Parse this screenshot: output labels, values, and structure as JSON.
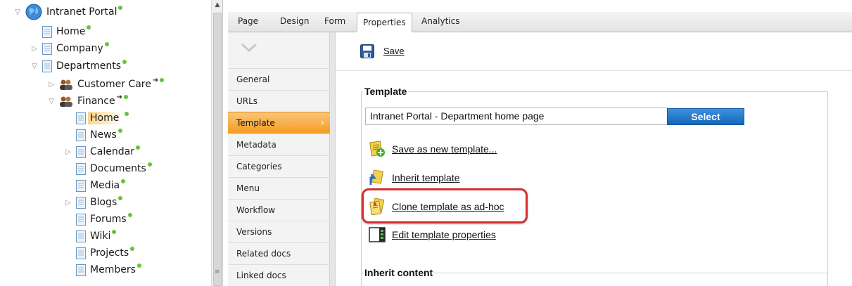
{
  "tree": {
    "items": [
      {
        "label": "Intranet Portal",
        "toggle": "expanded",
        "icon": "globe-icon",
        "dot": true,
        "arrow": false,
        "selected": false
      },
      {
        "label": "Home",
        "toggle": "none",
        "icon": "page-icon",
        "dot": true,
        "arrow": false,
        "selected": false
      },
      {
        "label": "Company",
        "toggle": "collapsed",
        "icon": "page-icon",
        "dot": true,
        "arrow": false,
        "selected": false
      },
      {
        "label": "Departments",
        "toggle": "expanded",
        "icon": "page-icon",
        "dot": true,
        "arrow": false,
        "selected": false
      },
      {
        "label": "Customer Care",
        "toggle": "collapsed",
        "icon": "people-icon",
        "dot": true,
        "arrow": true,
        "selected": false
      },
      {
        "label": "Finance",
        "toggle": "expanded",
        "icon": "people-icon",
        "dot": true,
        "arrow": true,
        "selected": false
      },
      {
        "label": "Home",
        "toggle": "none",
        "icon": "page-icon",
        "dot": true,
        "arrow": false,
        "selected": true
      },
      {
        "label": "News",
        "toggle": "none",
        "icon": "page-icon",
        "dot": true,
        "arrow": false,
        "selected": false
      },
      {
        "label": "Calendar",
        "toggle": "collapsed",
        "icon": "page-icon",
        "dot": true,
        "arrow": false,
        "selected": false
      },
      {
        "label": "Documents",
        "toggle": "none",
        "icon": "page-icon",
        "dot": true,
        "arrow": false,
        "selected": false
      },
      {
        "label": "Media",
        "toggle": "none",
        "icon": "page-icon",
        "dot": true,
        "arrow": false,
        "selected": false
      },
      {
        "label": "Blogs",
        "toggle": "collapsed",
        "icon": "page-icon",
        "dot": true,
        "arrow": false,
        "selected": false
      },
      {
        "label": "Forums",
        "toggle": "none",
        "icon": "page-icon",
        "dot": true,
        "arrow": false,
        "selected": false
      },
      {
        "label": "Wiki",
        "toggle": "none",
        "icon": "page-icon",
        "dot": true,
        "arrow": false,
        "selected": false
      },
      {
        "label": "Projects",
        "toggle": "none",
        "icon": "page-icon",
        "dot": true,
        "arrow": false,
        "selected": false
      },
      {
        "label": "Members",
        "toggle": "none",
        "icon": "page-icon",
        "dot": true,
        "arrow": false,
        "selected": false
      }
    ],
    "status_dot_color": "#64c43a"
  },
  "tabs": {
    "items": [
      {
        "label": "Page",
        "active": false
      },
      {
        "label": "Design",
        "active": false
      },
      {
        "label": "Form",
        "active": false
      },
      {
        "label": "Properties",
        "active": true
      },
      {
        "label": "Analytics",
        "active": false
      }
    ]
  },
  "vertical_tabs": {
    "items": [
      {
        "label": "General",
        "active": false
      },
      {
        "label": "URLs",
        "active": false
      },
      {
        "label": "Template",
        "active": true
      },
      {
        "label": "Metadata",
        "active": false
      },
      {
        "label": "Categories",
        "active": false
      },
      {
        "label": "Menu",
        "active": false
      },
      {
        "label": "Workflow",
        "active": false
      },
      {
        "label": "Versions",
        "active": false
      },
      {
        "label": "Related docs",
        "active": false
      },
      {
        "label": "Linked docs",
        "active": false
      }
    ],
    "active_color": "#f59b1f"
  },
  "toolbar": {
    "save_label": "Save"
  },
  "template_section": {
    "legend": "Template",
    "template_name": "Intranet Portal - Department home page",
    "select_label": "Select",
    "actions": [
      {
        "label": "Save as new template...",
        "icon": "save-template-icon"
      },
      {
        "label": "Inherit template",
        "icon": "inherit-template-icon"
      },
      {
        "label": "Clone template as ad-hoc",
        "icon": "clone-template-icon"
      },
      {
        "label": "Edit template properties",
        "icon": "template-properties-icon"
      }
    ],
    "highlight_color": "#d32f2f",
    "select_button_color": "#1566b8"
  },
  "inherit_section": {
    "legend": "Inherit content"
  }
}
